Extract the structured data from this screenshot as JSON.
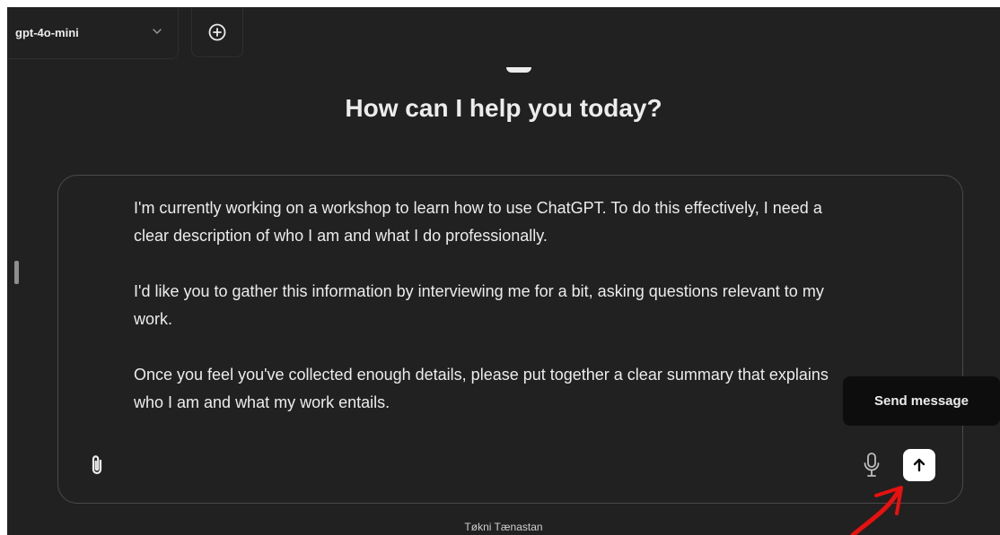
{
  "header": {
    "model_name": "gpt-4o-mini",
    "model_chevron_icon": "chevron-down-icon",
    "new_chat_icon": "plus-circle-icon"
  },
  "main": {
    "logo_icon": "assistant-logo-icon",
    "headline": "How can I help you today?"
  },
  "composer": {
    "paragraphs": [
      "I'm currently working on a workshop to learn how to use ChatGPT. To do this effectively, I need a clear description of who I am and what I do professionally.",
      "I'd like you to gather this information by interviewing me for a bit, asking questions relevant to my work.",
      "Once you feel you've collected enough details, please put together a clear summary that explains who I am and what my work entails."
    ],
    "attach_icon": "paperclip-icon",
    "mic_icon": "microphone-icon",
    "send_icon": "arrow-up-icon"
  },
  "tooltip": {
    "send_label": "Send message"
  },
  "footer": {
    "text": "Tøkni Tænastan"
  },
  "annotation": {
    "arrow_icon": "red-arrow-annotation",
    "color": "#e8110f"
  },
  "colors": {
    "background": "#212121",
    "text": "#ececec",
    "send_button": "#ffffff",
    "tooltip": "#0d0d0d",
    "composer_border": "#4a4a4a"
  }
}
